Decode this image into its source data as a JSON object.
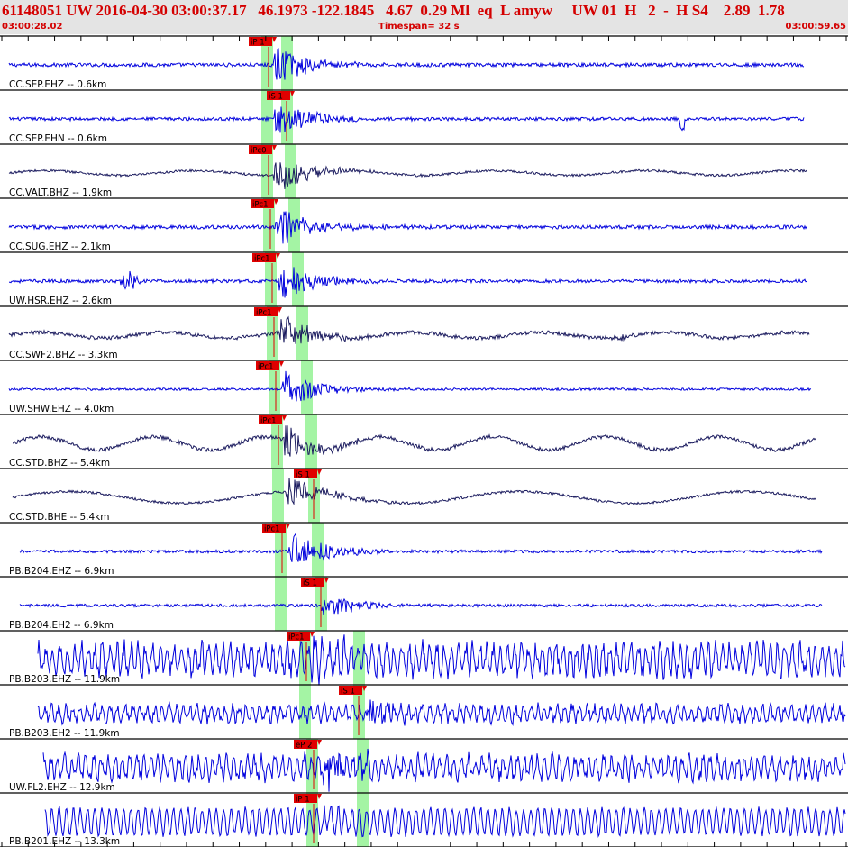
{
  "header": {
    "line": "61148051 UW 2016-04-30 03:00:37.17   46.1973 -122.1845   4.67  0.29 Ml  eq  L amyw     UW 01  H   2  -  H S4    2.89  1.78",
    "start_time": "03:00:28.02",
    "timespan": "Timespan=  32 s",
    "end_time": "03:00:59.65"
  },
  "colors": {
    "header_bg": "#e4e4e4",
    "header_text": "#d40000",
    "trace_blue": "#0000dd",
    "trace_navy": "#1a1a5e",
    "pick_flag": "#e00000",
    "pick_window": "#a4f4a4",
    "divider": "#000000"
  },
  "chart_data": {
    "type": "line",
    "title": "61148051 UW 2016-04-30 03:00:37.17",
    "x_unit": "seconds",
    "xlim": [
      "03:00:28.02",
      "03:00:59.65"
    ],
    "timespan_s": 32,
    "series": [
      {
        "label": "CC.SEP.EHZ -- 0.6km",
        "station": "SEP",
        "channel": "EHZ",
        "dist_km": 0.6,
        "color": "blue",
        "style": "dense",
        "noise": 0.08,
        "event_amp": 0.9,
        "lf_amp": 0.0,
        "lf_period": 0,
        "extra_bursts": [],
        "picks": [
          {
            "label": "iP 1",
            "type": "P"
          }
        ]
      },
      {
        "label": "CC.SEP.EHN -- 0.6km",
        "station": "SEP",
        "channel": "EHN",
        "dist_km": 0.6,
        "color": "blue",
        "style": "dense",
        "noise": 0.07,
        "event_amp": 0.8,
        "lf_amp": 0.0,
        "lf_period": 0,
        "extra_bursts": [
          {
            "t": 27.0,
            "amp": 0.35,
            "kind": "spike"
          }
        ],
        "picks": [
          {
            "label": "iS 1",
            "type": "S"
          }
        ]
      },
      {
        "label": "CC.VALT.BHZ -- 1.9km",
        "station": "VALT",
        "channel": "BHZ",
        "dist_km": 1.9,
        "color": "navy",
        "style": "dense",
        "noise": 0.05,
        "event_amp": 0.85,
        "lf_amp": 0.1,
        "lf_period": 6,
        "extra_bursts": [],
        "picks": [
          {
            "label": "iPc0",
            "type": "P"
          }
        ]
      },
      {
        "label": "CC.SUG.EHZ -- 2.1km",
        "station": "SUG",
        "channel": "EHZ",
        "dist_km": 2.1,
        "color": "blue",
        "style": "dense",
        "noise": 0.08,
        "event_amp": 0.95,
        "lf_amp": 0.0,
        "lf_period": 0,
        "extra_bursts": [],
        "picks": [
          {
            "label": "iPc1",
            "type": "P"
          }
        ]
      },
      {
        "label": "UW.HSR.EHZ -- 2.6km",
        "station": "HSR",
        "channel": "EHZ",
        "dist_km": 2.6,
        "color": "blue",
        "style": "dense",
        "noise": 0.07,
        "event_amp": 0.9,
        "lf_amp": 0.0,
        "lf_period": 0,
        "extra_bursts": [
          {
            "t": 4.8,
            "amp": 0.55,
            "kind": "burst"
          }
        ],
        "picks": [
          {
            "label": "iPc1",
            "type": "P"
          }
        ]
      },
      {
        "label": "CC.SWF2.BHZ -- 3.3km",
        "station": "SWF2",
        "channel": "BHZ",
        "dist_km": 3.3,
        "color": "navy",
        "style": "dense",
        "noise": 0.08,
        "event_amp": 0.8,
        "lf_amp": 0.12,
        "lf_period": 5,
        "extra_bursts": [
          {
            "t": 24.5,
            "amp": 0.18,
            "kind": "burst"
          }
        ],
        "picks": [
          {
            "label": "iPc1",
            "type": "P"
          }
        ]
      },
      {
        "label": "UW.SHW.EHZ -- 4.0km",
        "station": "SHW",
        "channel": "EHZ",
        "dist_km": 4.0,
        "color": "blue",
        "style": "dense",
        "noise": 0.05,
        "event_amp": 0.85,
        "lf_amp": 0.0,
        "lf_period": 0,
        "extra_bursts": [],
        "picks": [
          {
            "label": "iPc1",
            "type": "P"
          }
        ]
      },
      {
        "label": "CC.STD.BHZ -- 5.4km",
        "station": "STD",
        "channel": "BHZ",
        "dist_km": 5.4,
        "color": "navy",
        "style": "dense",
        "noise": 0.08,
        "event_amp": 0.75,
        "lf_amp": 0.28,
        "lf_period": 4.5,
        "extra_bursts": [],
        "picks": [
          {
            "label": "iPc1",
            "type": "P"
          }
        ]
      },
      {
        "label": "CC.STD.BHE -- 5.4km",
        "station": "STD",
        "channel": "BHE",
        "dist_km": 5.4,
        "color": "navy",
        "style": "dense",
        "noise": 0.05,
        "event_amp": 0.7,
        "lf_amp": 0.25,
        "lf_period": 9,
        "extra_bursts": [],
        "picks": [
          {
            "label": "iS 1",
            "type": "S"
          }
        ]
      },
      {
        "label": "PB.B204.EHZ -- 6.9km",
        "station": "B204",
        "channel": "EHZ",
        "dist_km": 6.9,
        "color": "blue",
        "style": "sparse",
        "noise": 0.07,
        "event_amp": 0.9,
        "lf_amp": 0.0,
        "lf_period": 0,
        "extra_bursts": [],
        "picks": [
          {
            "label": "iPc1",
            "type": "P"
          }
        ]
      },
      {
        "label": "PB.B204.EH2 -- 6.9km",
        "station": "B204",
        "channel": "EH2",
        "dist_km": 6.9,
        "color": "blue",
        "style": "sparse",
        "noise": 0.07,
        "event_amp": 0.6,
        "lf_amp": 0.0,
        "lf_period": 0,
        "extra_bursts": [],
        "picks": [
          {
            "label": "iS 1",
            "type": "S"
          }
        ]
      },
      {
        "label": "PB.B203.EHZ -- 11.9km",
        "station": "B203",
        "channel": "EHZ",
        "dist_km": 11.9,
        "color": "blue",
        "style": "wave",
        "noise": 0.55,
        "event_amp": 0.9,
        "lf_amp": 0.0,
        "lf_period": 0,
        "extra_bursts": [],
        "picks": [
          {
            "label": "iPc1",
            "type": "P"
          }
        ]
      },
      {
        "label": "PB.B203.EH2 -- 11.9km",
        "station": "B203",
        "channel": "EH2",
        "dist_km": 11.9,
        "color": "blue",
        "style": "wave",
        "noise": 0.3,
        "event_amp": 0.7,
        "lf_amp": 0.0,
        "lf_period": 0,
        "extra_bursts": [],
        "picks": [
          {
            "label": "iS 1",
            "type": "S"
          }
        ]
      },
      {
        "label": "UW.FL2.EHZ -- 12.9km",
        "station": "FL2",
        "channel": "EHZ",
        "dist_km": 12.9,
        "color": "blue",
        "style": "wave",
        "noise": 0.42,
        "event_amp": 0.85,
        "lf_amp": 0.0,
        "lf_period": 0,
        "extra_bursts": [],
        "picks": [
          {
            "label": "eP 2",
            "type": "P"
          }
        ]
      },
      {
        "label": "PB.B201.EHZ -- 13.3km",
        "station": "B201",
        "channel": "EHZ",
        "dist_km": 13.3,
        "color": "blue",
        "style": "osc",
        "noise": 0.55,
        "event_amp": 0.5,
        "lf_amp": 0.0,
        "lf_period": 0,
        "extra_bursts": [],
        "picks": [
          {
            "label": "iP 1",
            "type": "P"
          }
        ]
      }
    ]
  }
}
